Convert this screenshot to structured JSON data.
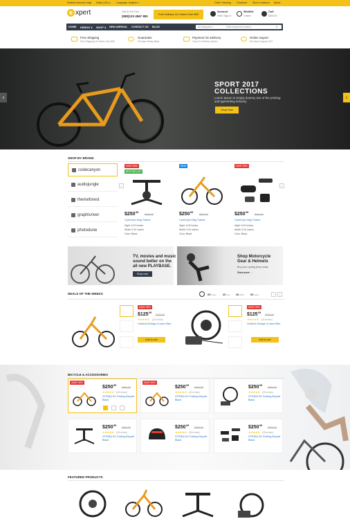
{
  "topbar": {
    "welcome": "Default welcome msg!",
    "currency": "Dollar (US) ∨",
    "language": "Language: English ∨",
    "links": [
      "Order Tracking",
      "Checkout",
      "Store Locations",
      "About"
    ]
  },
  "header": {
    "logo_letter": "e",
    "logo_text": "xpert",
    "call_label": "Call Us Toll Free",
    "phone": "(080)123 4567 891",
    "free_delivery": "Free Delivery On Orders Over $99",
    "account_label": "Account",
    "account_sub": "Hello! Sign in",
    "wishlist_label": "Wishlist",
    "wishlist_sub": "0 items",
    "cart_label": "Cart",
    "cart_sub": "$300.00"
  },
  "nav": {
    "items": [
      "HOME",
      "DEMOS ∨",
      "SHOP ∨",
      "NEW ARRIVAL",
      "CONTACT US",
      "BLOG"
    ],
    "category": "All Categories ∨",
    "search_placeholder": "Enter keywords to search..."
  },
  "services": [
    {
      "title": "Free Shipping",
      "sub": "Free Shipping On Order Over $99"
    },
    {
      "title": "Guarantee",
      "sub": "30 Days Money Back"
    },
    {
      "title": "Payment On Delivery",
      "sub": "Cash On Delivery Option"
    },
    {
      "title": "Online Suport",
      "sub": "We Have Support 24/7"
    }
  ],
  "hero": {
    "title_line1": "SPORT 2017",
    "title_line2": "COLLECTIONS",
    "text": "Lorem Ipsum is simply dummy text of the printing and typesetting industry.",
    "button": "Shop Now"
  },
  "brands": {
    "title": "SHOP BY BRAND",
    "items": [
      "codecanyon",
      "audiojungle",
      "themeforest",
      "graphicriver",
      "photodune"
    ]
  },
  "brand_products": [
    {
      "badge": "SAVE 30%",
      "badge2": "BESTSELLER",
      "price": "$250",
      "cents": "99",
      "old": "$500.00",
      "name": "CycleOps Mag Trainer",
      "specs": [
        "Hight: 6.02 inches",
        "Width: 5.20 inches",
        "Color: Black"
      ]
    },
    {
      "badge": "NEW",
      "badge2": "",
      "price": "$250",
      "cents": "99",
      "old": "$500.00",
      "name": "CycleOps Mag Trainer",
      "specs": [
        "Hight: 6.02 inches",
        "Width: 5.20 inches",
        "Color: Black"
      ]
    },
    {
      "badge": "SAVE 30%",
      "badge2": "",
      "price": "$250",
      "cents": "99",
      "old": "$500.00",
      "name": "CycleOps Mag Trainer",
      "specs": [
        "Hight: 6.02 inches",
        "Width: 5.20 inches",
        "Color: Black"
      ]
    }
  ],
  "promos": [
    {
      "line1": "TV, movies and music",
      "line2": "sound better on the",
      "line3": "all new PLAYBASE.",
      "button": "Shop now"
    },
    {
      "line1": "Shop Motorcycle",
      "line2": "Gear & Helmets",
      "sub": "Buy your cycling jersy today",
      "link": "View more →"
    }
  ],
  "deals": {
    "title": "DEALS OF THE WEEKS",
    "timer": [
      "05",
      "Days",
      "20",
      "Hrs",
      "40",
      "Mins",
      "60",
      "Secs"
    ],
    "items": [
      {
        "badge": "SAVE 30%",
        "price": "$125",
        "cents": "99",
        "old": "$250.00",
        "stars": "★★★★★",
        "reviews": "(05 review)",
        "name": "Holland Vintage Cruiser Bike",
        "button": "Add to cart"
      },
      {
        "badge": "SAVE 30%",
        "price": "$125",
        "cents": "99",
        "old": "$250.00",
        "stars": "★★★★★",
        "reviews": "(05 review)",
        "name": "Holland Vintage Cruiser Bike",
        "button": "Add to cart"
      }
    ]
  },
  "bicycles": {
    "title": "BICYCLE & ACCESSORIES",
    "items": [
      {
        "badge": "SAVE 30%",
        "price": "$250",
        "cents": "99",
        "old": "$500.00",
        "stars": "★★★★★",
        "reviews": "(05 review)",
        "name1": "STRIDA SX Folding Bicycle",
        "name2": "Black"
      },
      {
        "badge": "SAVE 30%",
        "price": "$250",
        "cents": "99",
        "old": "$500.00",
        "stars": "★★★★★",
        "reviews": "(05 review)",
        "name1": "STRIDA SX Folding Bicycle",
        "name2": "Black"
      },
      {
        "badge": "",
        "price": "$250",
        "cents": "99",
        "old": "$500.00",
        "stars": "★★★★★",
        "reviews": "(05 review)",
        "name1": "STRIDA SX Folding Bicycle",
        "name2": "Black"
      },
      {
        "badge": "",
        "price": "$250",
        "cents": "99",
        "old": "$500.00",
        "stars": "★★★★★",
        "reviews": "(05 review)",
        "name1": "STRIDA SX Folding Bicycle",
        "name2": "Black"
      },
      {
        "badge": "",
        "price": "$250",
        "cents": "99",
        "old": "$500.00",
        "stars": "★★★★★",
        "reviews": "(05 review)",
        "name1": "STRIDA SX Folding Bicycle",
        "name2": "Black"
      },
      {
        "badge": "",
        "price": "$250",
        "cents": "99",
        "old": "$500.00",
        "stars": "★★★★★",
        "reviews": "(05 review)",
        "name1": "STRIDA SX Folding Bicycle",
        "name2": "Black"
      }
    ]
  },
  "featured": {
    "title": "FEATURED PRODUCTS"
  },
  "colors": {
    "accent": "#f4c117",
    "nav": "#333a48",
    "badge_red": "#e53935",
    "badge_green": "#4caf50",
    "badge_blue": "#1e88e5"
  }
}
